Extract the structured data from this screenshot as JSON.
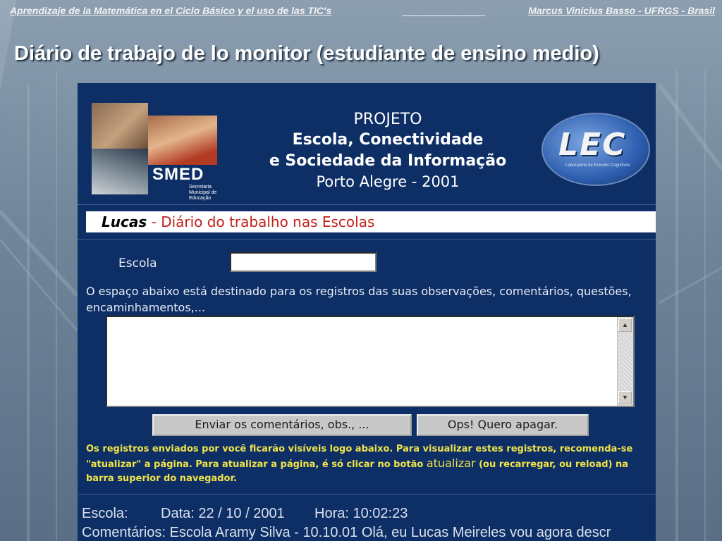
{
  "header": {
    "left": "Aprendizaje de la Matemática en el Ciclo Básico y el uso de las TIC's",
    "right": "Marcus Vinicius Basso - UFRGS - Brasil"
  },
  "slide_title": "Diário de trabajo de lo monitor (estudiante de ensino medio)",
  "screenshot": {
    "project": {
      "line1": "PROJETO",
      "line2": "Escola, Conectividade",
      "line3": "e Sociedade da Informação",
      "line4": "Porto Alegre - 2001"
    },
    "smed_logo": {
      "text": "SMED",
      "subtext": "Secretaria Municipal de Educação"
    },
    "lec_logo": {
      "text": "LEC",
      "subtext": "Laboratório de Estudos Cognitivos"
    },
    "name_bar": {
      "name": "Lucas",
      "separator": " - ",
      "title": "Diário do trabalho nas Escolas"
    },
    "form": {
      "escola_label": "Escola",
      "escola_value": "",
      "description": "O espaço abaixo está destinado para os registros das suas observações, comentários, questões, encaminhamentos,...",
      "comments_value": "",
      "send_button": "Enviar os comentários, obs., ...",
      "clear_button": "Ops! Quero apagar."
    },
    "note": {
      "part1": "Os registros enviados por você ficarão visíveis logo abaixo. Para visualizar estes registros, recomenda-se \"atualizar\" a página. Para atualizar a página, é só clicar no botão ",
      "highlight": "atualizar",
      "part2": " (ou recarregar, ou reload) na barra superior do navegador."
    },
    "record": {
      "escola": "Escola:",
      "data": "Data: 22 / 10 / 2001",
      "hora": "Hora: 10:02:23",
      "comentarios": "Comentários: Escola Aramy Silva - 10.10.01 Olá, eu Lucas Meireles vou agora descr"
    },
    "colors": {
      "page_bg": "#0e2f65",
      "title_red": "#c0201a",
      "note_yellow": "#f0e44a"
    }
  }
}
